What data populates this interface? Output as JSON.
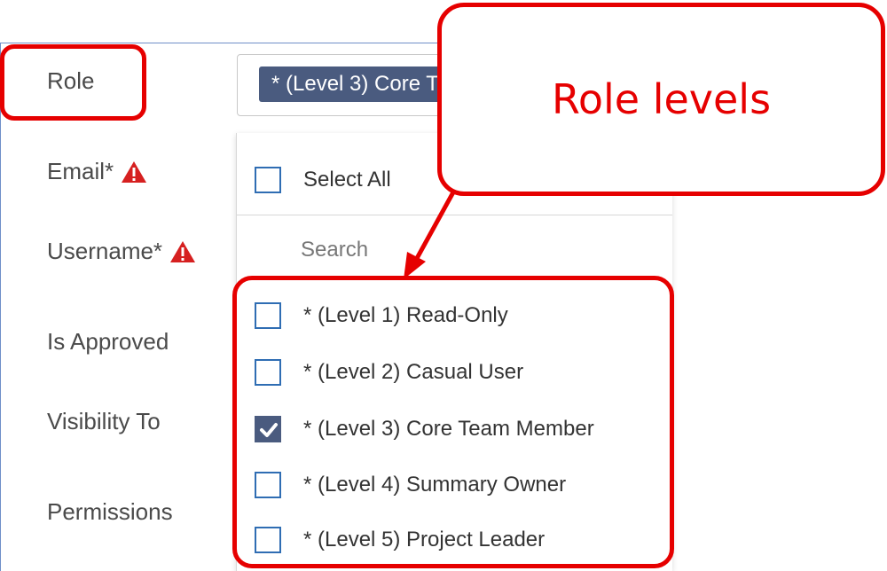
{
  "form": {
    "labels": {
      "role": "Role",
      "email": "Email*",
      "username": "Username*",
      "is_approved": "Is Approved",
      "visibility_to": "Visibility To",
      "permissions": "Permissions"
    },
    "role_selected_tag": "* (Level 3) Core Team Member"
  },
  "dropdown": {
    "select_all_label": "Select All",
    "search_placeholder": "Search",
    "options": [
      {
        "label": "* (Level 1) Read-Only",
        "checked": false
      },
      {
        "label": "* (Level 2) Casual User",
        "checked": false
      },
      {
        "label": "* (Level 3) Core Team Member",
        "checked": true
      },
      {
        "label": "* (Level 4) Summary Owner",
        "checked": false
      },
      {
        "label": "* (Level 5) Project Leader",
        "checked": false
      }
    ]
  },
  "annotation": {
    "callout_text": "Role levels",
    "color": "#e60000"
  },
  "colors": {
    "tag_bg": "#4a5b7f",
    "checkbox_border": "#2f6db3",
    "warning": "#d62020"
  },
  "icons": {
    "warning": "warning-triangle-icon",
    "checkmark": "checkmark-icon"
  }
}
